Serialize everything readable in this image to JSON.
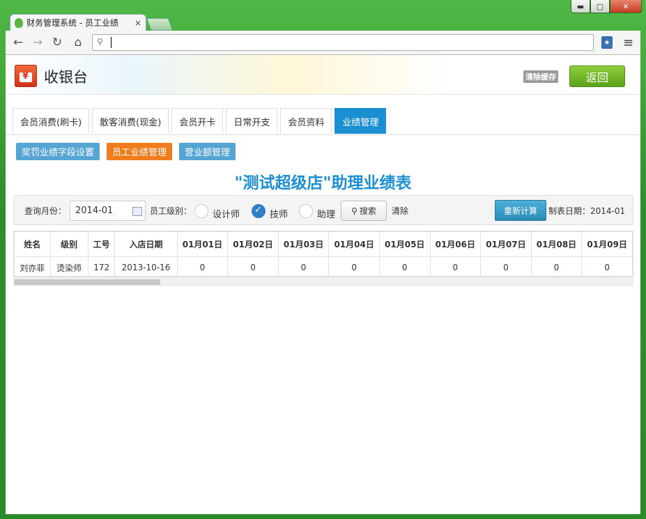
{
  "browser": {
    "tab_title": "财务管理系统 - 员工业绩",
    "tab_close": "×",
    "window_buttons": {
      "minimize": "▬",
      "maximize": "▢",
      "close": "✕"
    },
    "nav": {
      "back": "←",
      "forward": "→",
      "reload": "↻",
      "home": "⌂",
      "menu": "≡"
    },
    "address_value": ""
  },
  "header": {
    "title": "收银台",
    "clear_cache": "清除缓存",
    "back": "返回"
  },
  "tabs": [
    {
      "label": "会员消费(刷卡)",
      "active": false
    },
    {
      "label": "散客消费(现金)",
      "active": false
    },
    {
      "label": "会员开卡",
      "active": false
    },
    {
      "label": "日常开支",
      "active": false
    },
    {
      "label": "会员资料",
      "active": false
    },
    {
      "label": "业绩管理",
      "active": true
    }
  ],
  "subnav": [
    {
      "label": "奖罚业绩字段设置",
      "color": "#54a4d4"
    },
    {
      "label": "员工业绩管理",
      "color": "#f07c1c"
    },
    {
      "label": "营业额管理",
      "color": "#54a4d4"
    }
  ],
  "report_title": "\"测试超级店\"助理业绩表",
  "filters": {
    "month_label": "查询月份：",
    "month_value": "2014-01",
    "level_label": "员工级别：",
    "levels": [
      {
        "label": "设计师",
        "checked": false
      },
      {
        "label": "技师",
        "checked": true
      },
      {
        "label": "助理",
        "checked": false
      }
    ],
    "search": "搜索",
    "clear": "清除",
    "recalc": "重新计算",
    "date": "制表日期：2014-01"
  },
  "table": {
    "columns": [
      "姓名",
      "级别",
      "工号",
      "入店日期",
      "01月01日",
      "01月02日",
      "01月03日",
      "01月04日",
      "01月05日",
      "01月06日",
      "01月07日",
      "01月08日",
      "01月09日"
    ],
    "rows": [
      [
        "刘亦菲",
        "烫染师",
        "172",
        "2013-10-16",
        "0",
        "0",
        "0",
        "0",
        "0",
        "0",
        "0",
        "0",
        "0"
      ]
    ]
  },
  "colors": {
    "accent": "#1b8fd1",
    "orange": "#f07c1c",
    "green": "#5aa21a"
  }
}
